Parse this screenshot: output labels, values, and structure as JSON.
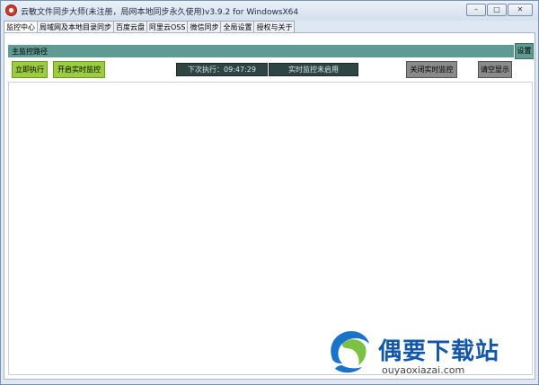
{
  "window": {
    "title": "云敏文件同步大师(未注册，局网本地同步永久使用)v3.9.2 for WindowsX64"
  },
  "tabs": [
    {
      "label": "监控中心"
    },
    {
      "label": "局域网及本地目录同步"
    },
    {
      "label": "百度云盘"
    },
    {
      "label": "阿里云OSS"
    },
    {
      "label": "微信同步"
    },
    {
      "label": "全局设置"
    },
    {
      "label": "授权与关于"
    }
  ],
  "monitor": {
    "path_label": "主监控路径",
    "settings_label": "设置",
    "run_now_label": "立即执行",
    "start_realtime_label": "开启实时监控",
    "next_exec": "下次执行：09:47:29",
    "realtime_status": "实时监控未启用",
    "stop_realtime_label": "关闭实时监控",
    "clear_display_label": "请空显示"
  },
  "watermark": {
    "brand": "偶要下载站",
    "url": "ouyaoxiazai.com"
  }
}
